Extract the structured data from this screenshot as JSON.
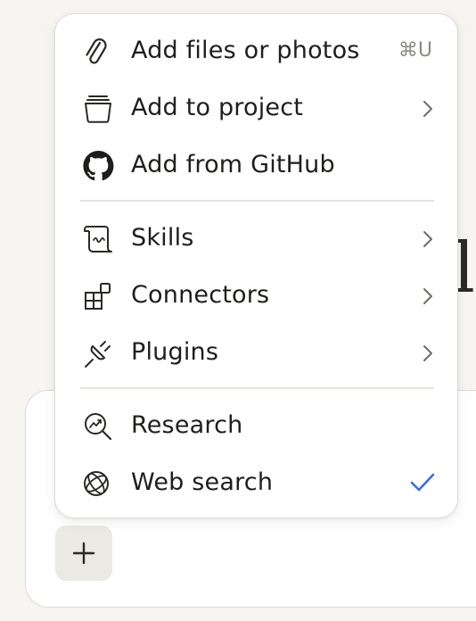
{
  "background": {
    "heading_fragment": "l",
    "plus_button_label": "+"
  },
  "menu": {
    "sections": [
      [
        {
          "icon": "paperclip-icon",
          "label": "Add files or photos",
          "shortcut": "⌘U",
          "submenu": false
        },
        {
          "icon": "project-folder-icon",
          "label": "Add to project",
          "submenu": true
        },
        {
          "icon": "github-icon",
          "label": "Add from GitHub",
          "submenu": false
        }
      ],
      [
        {
          "icon": "scroll-icon",
          "label": "Skills",
          "submenu": true
        },
        {
          "icon": "connectors-grid-icon",
          "label": "Connectors",
          "submenu": true
        },
        {
          "icon": "plug-icon",
          "label": "Plugins",
          "submenu": true
        }
      ],
      [
        {
          "icon": "research-magnifier-icon",
          "label": "Research",
          "submenu": false
        },
        {
          "icon": "globe-icon",
          "label": "Web search",
          "submenu": false,
          "checked": true
        }
      ]
    ]
  },
  "colors": {
    "check": "#3d6fd6",
    "text": "#1f1e1c",
    "muted": "#8c8a85",
    "divider": "#e4e2dd"
  }
}
